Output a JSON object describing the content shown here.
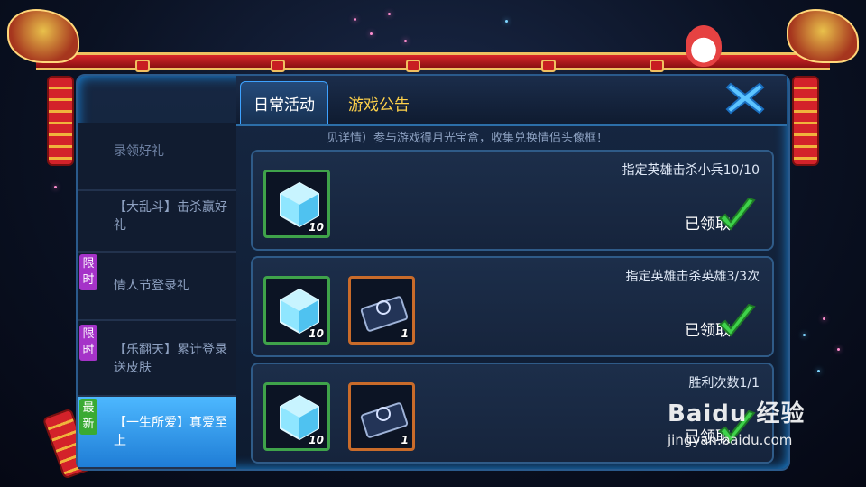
{
  "tabs": [
    {
      "label": "日常活动",
      "active": true
    },
    {
      "label": "游戏公告",
      "active": false
    }
  ],
  "sidebar": {
    "items": [
      {
        "label": "录领好礼",
        "tag": ""
      },
      {
        "label": "【大乱斗】击杀赢好礼",
        "tag": ""
      },
      {
        "label": "情人节登录礼",
        "tag": "限时"
      },
      {
        "label": "【乐翻天】累计登录送皮肤",
        "tag": "限时"
      },
      {
        "label": "【一生所爱】真爱至上",
        "tag": "最新",
        "active": true
      }
    ]
  },
  "content": {
    "top_note": "见详情）参与游戏得月光宝盒，收集兑换情侣头像框！",
    "rewards": [
      {
        "title": "指定英雄击杀小兵10/10",
        "status": "已领取",
        "items": [
          {
            "icon": "crystal-icon",
            "qty": "10"
          }
        ]
      },
      {
        "title": "指定英雄击杀英雄3/3次",
        "status": "已领取",
        "items": [
          {
            "icon": "crystal-icon",
            "qty": "10"
          },
          {
            "icon": "skin-card-icon",
            "qty": "1"
          }
        ]
      },
      {
        "title": "胜利次数1/1",
        "status": "已领取",
        "items": [
          {
            "icon": "crystal-icon",
            "qty": "10"
          },
          {
            "icon": "skin-card-icon",
            "qty": "1"
          }
        ]
      }
    ]
  },
  "watermark": {
    "brand": "Baidu 经验",
    "url": "jingyan.baidu.com"
  },
  "colors": {
    "active_tab_text": "#ffffff",
    "inactive_tab_text": "#ffd24a",
    "active_sidebar": "#2f95ee",
    "limit_tag": "#a533c8",
    "new_tag": "#3aaa33",
    "check": "#3ed24a"
  }
}
